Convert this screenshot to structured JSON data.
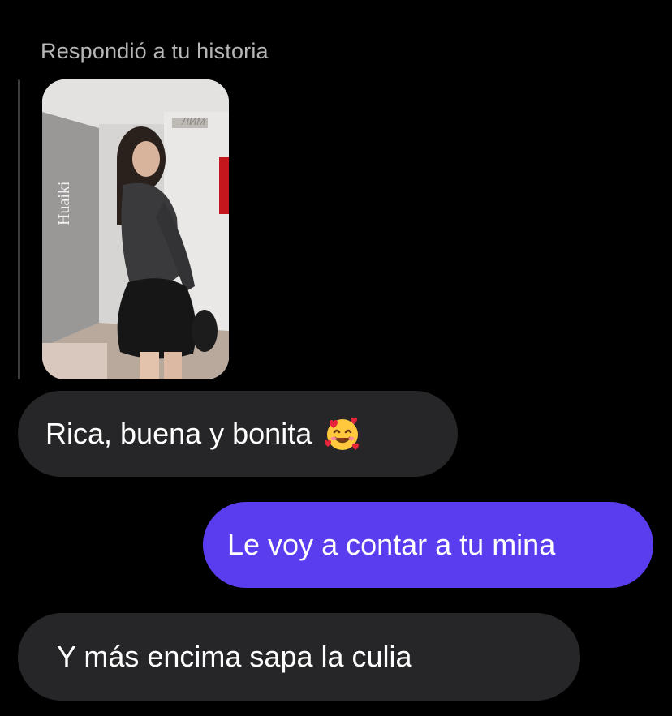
{
  "reply_context": {
    "header": "Respondió a tu historia",
    "story": {
      "watermark": "Huaiki",
      "corner_text": "ЛИМ"
    }
  },
  "messages": [
    {
      "direction": "incoming",
      "text": "Rica, buena y bonita",
      "emoji": "smiling-face-with-hearts-icon"
    },
    {
      "direction": "outgoing",
      "text": "Le voy a contar a tu mina"
    },
    {
      "direction": "incoming",
      "text": "Y más encima sapa la culia"
    }
  ],
  "colors": {
    "background": "#000000",
    "incoming_bubble": "#262628",
    "outgoing_bubble": "#5b3df0",
    "header_text": "#b6b6b6"
  }
}
